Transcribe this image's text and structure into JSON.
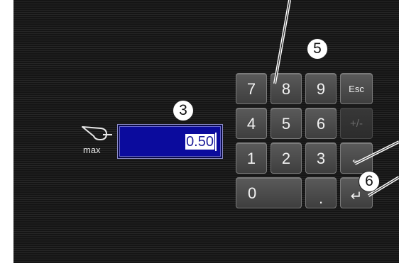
{
  "quantity_label": "max",
  "input": {
    "value": "0.50"
  },
  "keypad": {
    "row1": [
      "7",
      "8",
      "9",
      "Esc"
    ],
    "row2": [
      "4",
      "5",
      "6",
      "+/-"
    ],
    "row3": [
      "1",
      "2",
      "3",
      "←"
    ],
    "row4": [
      "0",
      ".",
      "↵"
    ]
  },
  "callouts": {
    "c3": "3",
    "c5": "5",
    "c6": "6"
  },
  "icons": {
    "ladle": "ladle-icon"
  },
  "colors": {
    "field_bg": "#0b0b9d",
    "key_bg": "#4a4a4a",
    "screen_bg": "#1c1c1c"
  }
}
